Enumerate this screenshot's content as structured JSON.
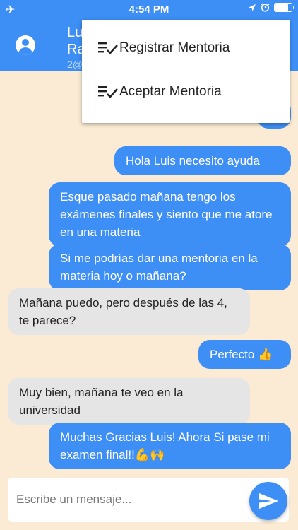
{
  "status_bar": {
    "time": "4:54 PM",
    "airplane_icon": "airplane-icon",
    "location_icon": "location-arrow-icon",
    "alarm_icon": "alarm-clock-icon",
    "battery_level": 0.9
  },
  "header": {
    "contact_name": "Lu\nRa",
    "contact_subtitle": "2@"
  },
  "menu": {
    "items": [
      {
        "label": "Registrar Mentoria",
        "icon": "playlist-check-icon"
      },
      {
        "label": "Aceptar Mentoria",
        "icon": "playlist-check-icon"
      }
    ]
  },
  "messages": [
    {
      "from": "me",
      "text": "Hola Luis necesito ayuda"
    },
    {
      "from": "me",
      "text": "Esque pasado mañana tengo los exámenes finales y siento que me atore en una materia"
    },
    {
      "from": "me",
      "text": "Si me podrías dar una mentoria en la materia hoy o mañana?"
    },
    {
      "from": "them",
      "text": "Mañana puedo, pero después de las 4, te parece?"
    },
    {
      "from": "me",
      "text": "Perfecto 👍"
    },
    {
      "from": "them",
      "text": "Muy bien, mañana te veo en la universidad"
    },
    {
      "from": "me",
      "text": "Muchas Gracias Luis! Ahora Si pase mi examen final!!💪🙌"
    }
  ],
  "composer": {
    "placeholder": "Escribe un mensaje...",
    "send_icon": "send-icon"
  }
}
